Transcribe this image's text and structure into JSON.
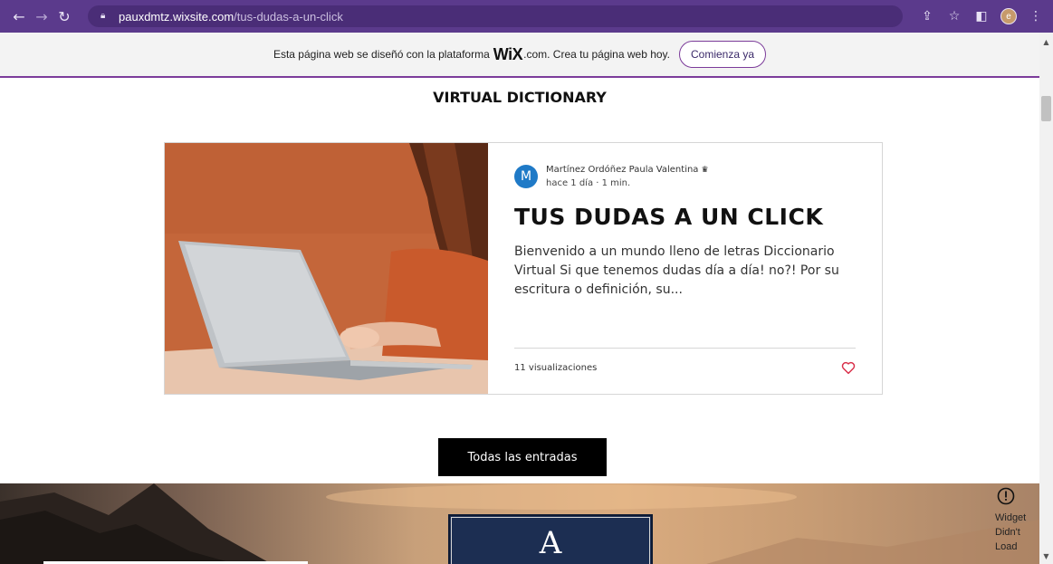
{
  "browser": {
    "url_host": "pauxdmtz.wixsite.com",
    "url_path": "/tus-dudas-a-un-click",
    "profile_initial": "e"
  },
  "wix_banner": {
    "text_before": "Esta página web se diseñó con la plataforma",
    "logo": "WiX",
    "text_after": ".com. Crea tu página web hoy.",
    "cta_label": "Comienza ya"
  },
  "site": {
    "title": "VIRTUAL DICTIONARY"
  },
  "post": {
    "author_initial": "M",
    "author_name": "Martínez Ordóñez Paula Valentina",
    "meta": "hace 1 día  ·  1 min.",
    "title": "TUS DUDAS A UN CLICK",
    "excerpt": "Bienvenido a un mundo lleno de letras Diccionario Virtual Si que tenemos dudas día a día! no?! Por su escritura o definición, su...",
    "views": "11 visualizaciones",
    "image_description": "person-using-laptop-photo"
  },
  "all_posts_button": "Todas las entradas",
  "hero": {
    "letter": "A"
  },
  "widget_notice": {
    "line1": "Widget",
    "line2": "Didn't",
    "line3": "Load"
  },
  "icons": {
    "back": "arrow-left-icon",
    "forward": "arrow-right-icon",
    "reload": "reload-icon",
    "lock": "lock-icon",
    "share": "share-icon",
    "star": "star-icon",
    "sidepanel": "side-panel-icon",
    "menu": "kebab-menu-icon",
    "crown": "crown-icon",
    "heart": "heart-icon",
    "warning": "warning-icon"
  },
  "colors": {
    "chrome": "#5b3a8c",
    "wix_accent": "#7c3c9a",
    "like": "#d9304a",
    "avatar": "#1f7ac7"
  }
}
